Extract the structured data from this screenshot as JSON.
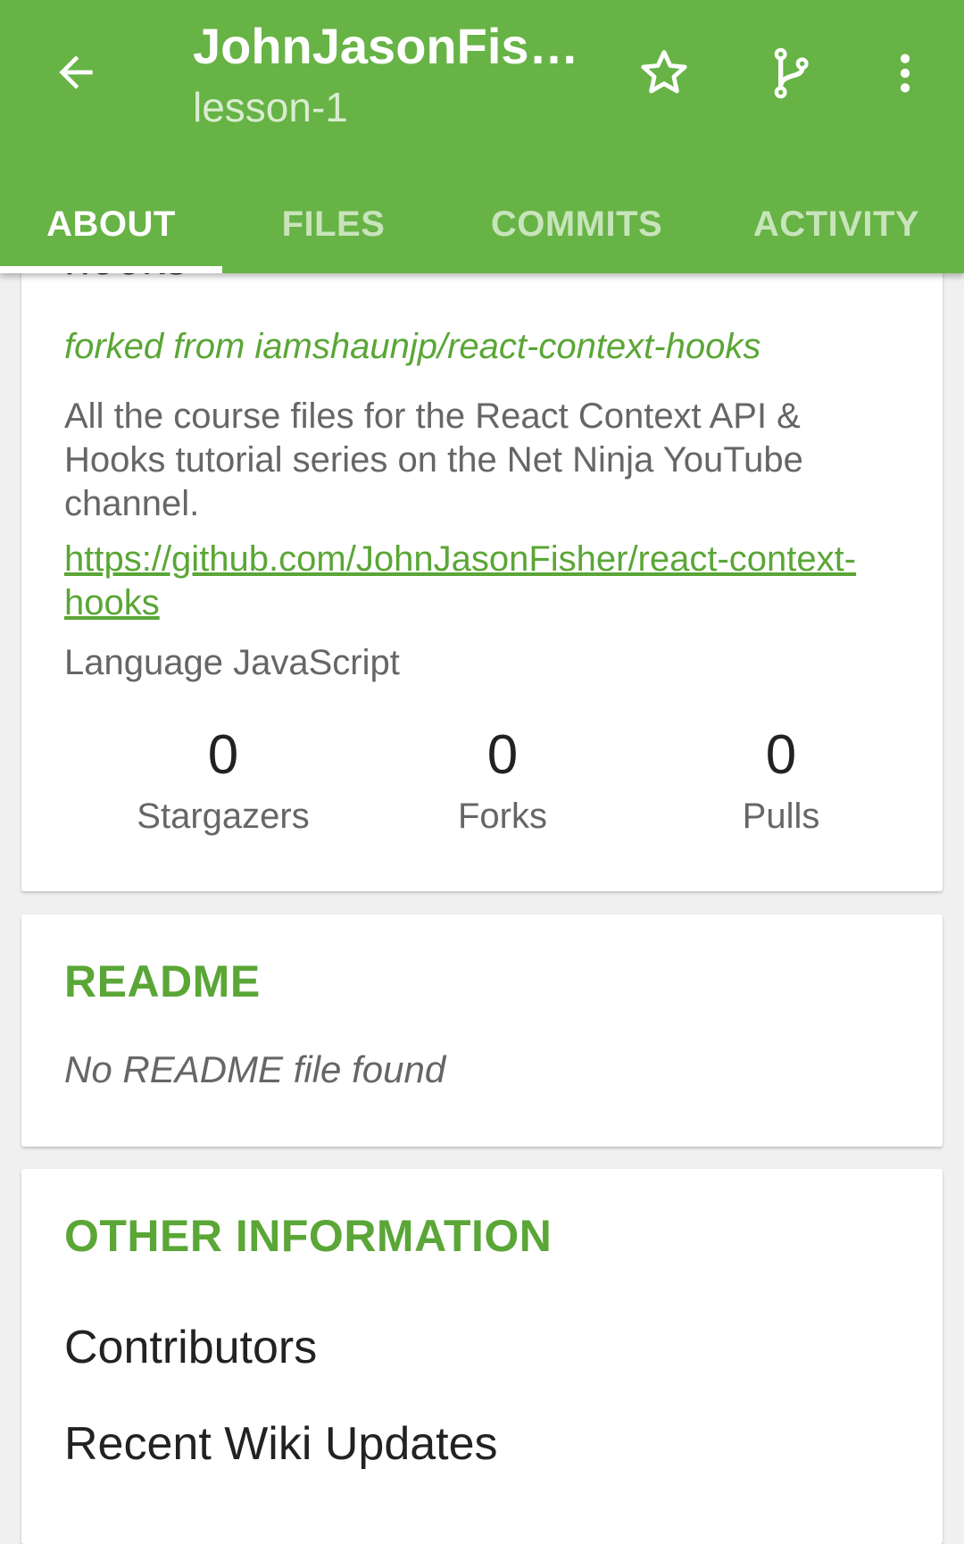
{
  "appbar": {
    "title": "JohnJasonFis…",
    "subtitle": "lesson-1",
    "icons": [
      "back-arrow-icon",
      "star-icon",
      "branch-icon",
      "more-vert-icon"
    ],
    "color": "#67b346"
  },
  "tabs": [
    {
      "label": "ABOUT",
      "active": true
    },
    {
      "label": "FILES",
      "active": false
    },
    {
      "label": "COMMITS",
      "active": false
    },
    {
      "label": "ACTIVITY",
      "active": false
    }
  ],
  "about": {
    "repo_name_partial": "hooks",
    "forked_from": "forked from iamshaunjp/react-context-hooks",
    "description": "All the course files for the React Context API & Hooks tutorial series on the Net Ninja YouTube channel.",
    "link": "https://github.com/JohnJasonFisher/react-context-hooks",
    "language": "Language JavaScript",
    "stats": [
      {
        "count": "0",
        "label": "Stargazers"
      },
      {
        "count": "0",
        "label": "Forks"
      },
      {
        "count": "0",
        "label": "Pulls"
      }
    ]
  },
  "readme": {
    "heading": "README",
    "empty_text": "No README file found"
  },
  "other_information": {
    "heading": "OTHER INFORMATION",
    "items": [
      "Contributors",
      "Recent Wiki Updates"
    ]
  }
}
